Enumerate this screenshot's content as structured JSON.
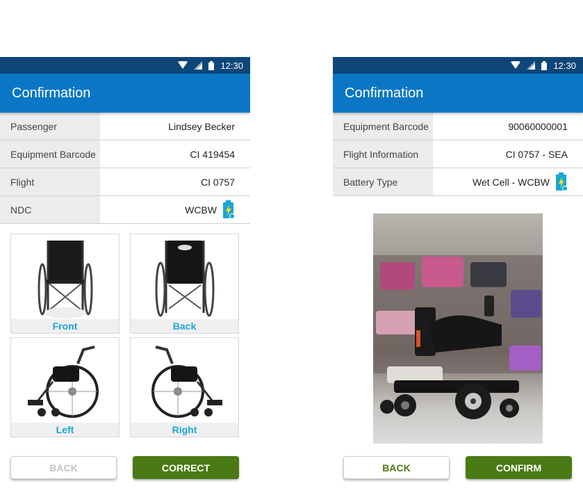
{
  "status_bar": {
    "time": "12:30"
  },
  "left_screen": {
    "title": "Confirmation",
    "rows": [
      {
        "label": "Passenger",
        "value": "Lindsey Becker"
      },
      {
        "label": "Equipment Barcode",
        "value": "CI 419454"
      },
      {
        "label": "Flight",
        "value": "CI 0757"
      },
      {
        "label": "NDC",
        "value": "WCBW",
        "icon": "battery-charging-icon"
      }
    ],
    "thumbnails": [
      {
        "label": "Front",
        "icon": "wheelchair-front-icon"
      },
      {
        "label": "Back",
        "icon": "wheelchair-back-icon"
      },
      {
        "label": "Left",
        "icon": "wheelchair-left-icon"
      },
      {
        "label": "Right",
        "icon": "wheelchair-right-icon"
      }
    ],
    "back_label": "BACK",
    "correct_label": "CORRECT"
  },
  "right_screen": {
    "title": "Confirmation",
    "rows": [
      {
        "label": "Equipment Barcode",
        "value": "90060000001"
      },
      {
        "label": "Flight Information",
        "value": "CI 0757 - SEA"
      },
      {
        "label": "Battery Type",
        "value": "Wet Cell - WCBW",
        "icon": "battery-charging-icon"
      }
    ],
    "photo_icon": "power-wheelchair-photo",
    "back_label": "BACK",
    "confirm_label": "CONFIRM"
  },
  "colors": {
    "status_bar": "#0d4679",
    "app_bar": "#0b77c4",
    "primary_button": "#4a7a14",
    "thumb_label": "#1aa6d6",
    "battery_icon": "#1aa6d6"
  }
}
